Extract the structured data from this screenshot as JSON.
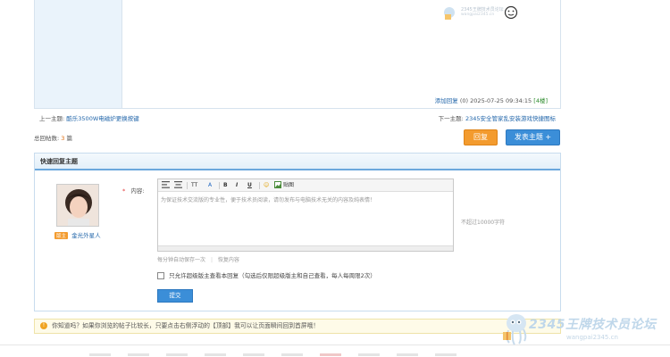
{
  "post": {
    "reply_link": "添加回复",
    "reply_count": "(0)",
    "datetime": "2025-07-25 09:34:15",
    "floor": "[4楼]"
  },
  "watermark": {
    "text": "2345王牌技术员论坛",
    "sub": "wangpai2345.cn"
  },
  "topic_nav": {
    "prev_label": "上一主题:",
    "prev_title": "酷乐3500W电磁炉更换按键",
    "next_label": "下一主题:",
    "next_title": "2345安全管家乱安装游戏快捷图标"
  },
  "total": {
    "label": "总回帖数:",
    "count": "3",
    "unit": "篇"
  },
  "buttons": {
    "reply": "回复",
    "new_topic": "发表主题 +"
  },
  "quick_reply": {
    "title": "快速回复主题",
    "username": "金光外星人",
    "badge": "版主",
    "content_label": "内容:",
    "required_mark": "*",
    "placeholder": "为保证技术交流版的专业性，便于技术员阅读，请勿发布与电脑技术无关的内容及纯表情！",
    "limit": "不超过10000字符",
    "autosave": "每分钟自动保存一次",
    "restore": "恢复内容",
    "checkbox_label": "只允许超级版主查看本回复（勾选后仅限超级版主和自己查看，每人每周限2次）",
    "submit": "提交",
    "toolbar": {
      "font_size": "TT",
      "font_color": "A",
      "bold": "B",
      "italic": "I",
      "underline": "U",
      "emoji": "☺",
      "image": "贴图"
    }
  },
  "tip": {
    "text": "你知道吗？如果你浏览的帖子比较长，只要点击右侧浮动的【顶部】我可以让页面瞬间回到首屏哦！"
  },
  "logo": {
    "text": "2345王牌技术员论坛",
    "sub": "wangpai2345.cn"
  },
  "colors": {
    "accent_blue": "#3b8ed8",
    "accent_orange": "#f39b2e",
    "link": "#2266aa"
  }
}
